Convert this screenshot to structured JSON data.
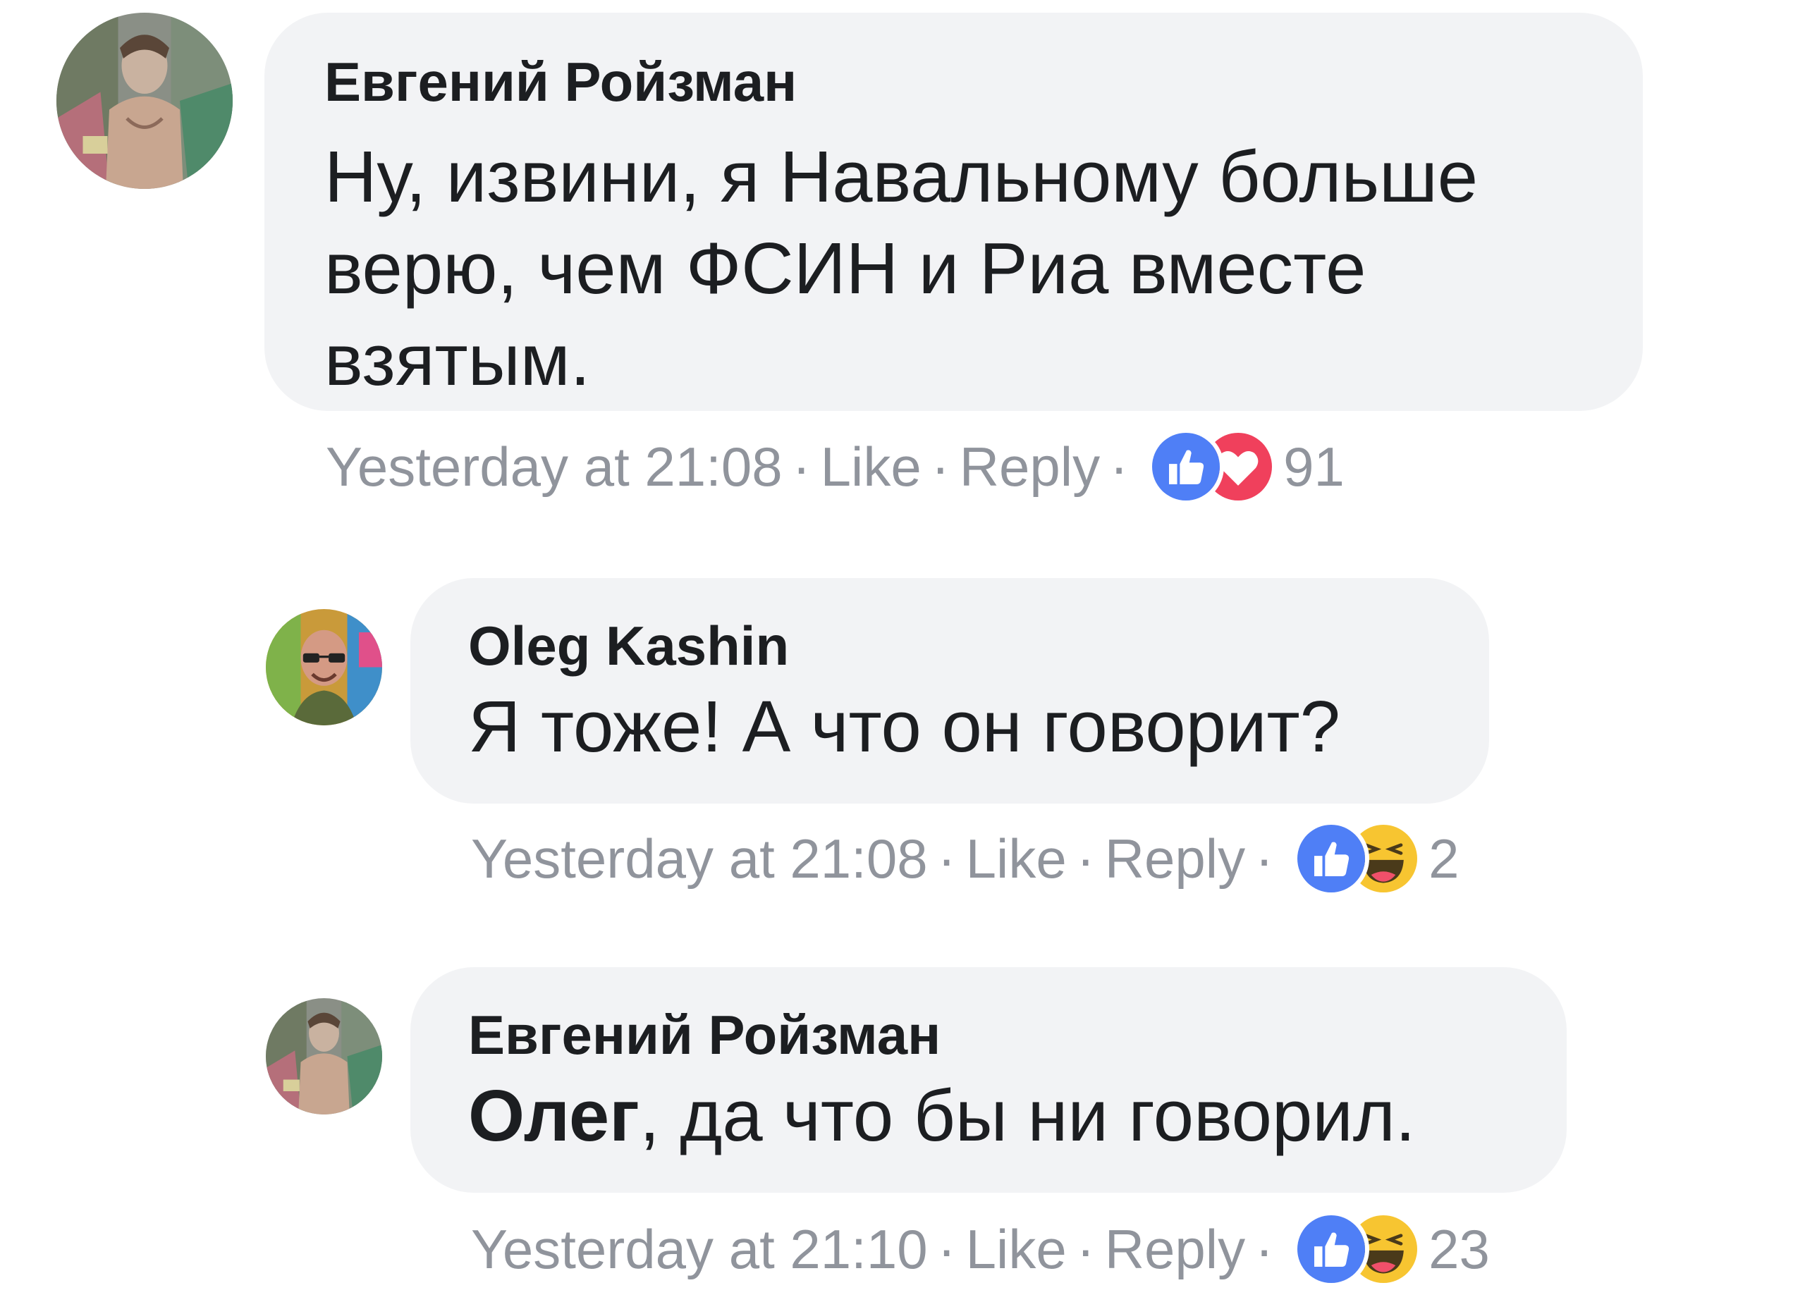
{
  "comments": [
    {
      "author": "Евгений Ройзман",
      "text": "Ну, извини, я Навальному больше верю, чем ФСИН и Риа вместе взятым.",
      "timestamp": "Yesterday at 21:08",
      "like_label": "Like",
      "reply_label": "Reply",
      "reactions": [
        "like-icon",
        "love-icon"
      ],
      "reaction_count": "91"
    },
    {
      "author": "Oleg Kashin",
      "text": "Я тоже! А что он говорит?",
      "timestamp": "Yesterday at 21:08",
      "like_label": "Like",
      "reply_label": "Reply",
      "reactions": [
        "like-icon",
        "haha-icon"
      ],
      "reaction_count": "2"
    },
    {
      "author": "Евгений Ройзман",
      "mention": "Олег",
      "text": ", да что бы ни говорил.",
      "timestamp": "Yesterday at 21:10",
      "like_label": "Like",
      "reply_label": "Reply",
      "reactions": [
        "like-icon",
        "haha-icon"
      ],
      "reaction_count": "23"
    }
  ],
  "separator": "·",
  "colors": {
    "bubble": "#f2f3f5",
    "meta_text": "#90949c",
    "like_blue": "#4f7ff6",
    "love_red": "#f0405c",
    "haha_yellow": "#f7c531"
  }
}
